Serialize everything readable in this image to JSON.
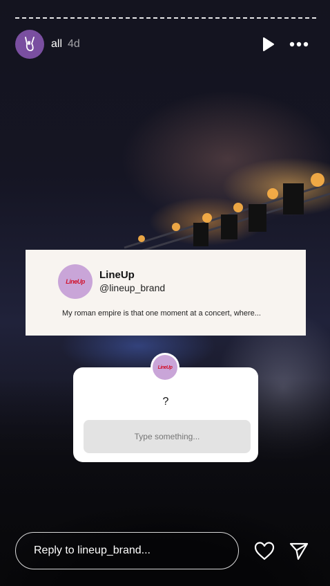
{
  "header": {
    "username": "all",
    "time": "4d"
  },
  "icons": {
    "avatar": "rock-hand-icon",
    "play": "play-icon",
    "more": "more-icon",
    "heart": "heart-icon",
    "send": "send-icon"
  },
  "card": {
    "brand_name": "LineUp",
    "handle": "@lineup_brand",
    "text": "My roman empire is that one moment at a concert, where...",
    "logo_text": "LineUp"
  },
  "question": {
    "prompt": "?",
    "placeholder": "Type something..."
  },
  "reply": {
    "placeholder": "Reply to lineup_brand..."
  },
  "colors": {
    "card_bg": "#f8f4f0",
    "avatar_purple": "#7a4fa0",
    "brand_avatar": "#c9a5d8"
  }
}
